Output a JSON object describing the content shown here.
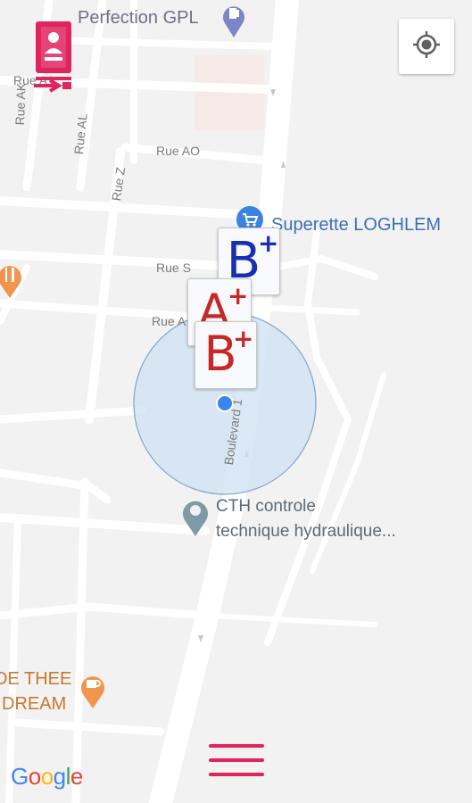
{
  "colors": {
    "map_bg": "#f2f2f2",
    "road": "#ffffff",
    "accuracy_fill": "#cfe0f3",
    "accuracy_stroke": "#7fa6cf",
    "location_dot": "#3a86ee",
    "accent": "#e0245e",
    "blood_b": "#1a2fb0",
    "blood_a": "#c62828"
  },
  "pois": {
    "perfection": "Perfection GPL",
    "superette": "Superette LOGHLEM",
    "cth_line1": "CTH controle",
    "cth_line2": "technique hydraulique...",
    "cafe_line1": "DE THEE",
    "cafe_line2": "DREAM"
  },
  "streets": {
    "rue_a1": "Rue A1",
    "rue_ak": "Rue AK",
    "rue_al": "Rue AL",
    "rue_ao": "Rue AO",
    "rue_z": "Rue Z",
    "rue_s": "Rue S",
    "rue_a": "Rue A",
    "boulevard": "Boulevard 1"
  },
  "markers": [
    {
      "group": "B",
      "sign": "+"
    },
    {
      "group": "A",
      "sign": "+"
    },
    {
      "group": "B",
      "sign": "+"
    }
  ],
  "icons": {
    "profile": "profile-card-icon",
    "locate": "my-location-icon",
    "menu": "hamburger-menu-icon",
    "gas": "gas-station-icon",
    "cart": "shopping-cart-icon",
    "pin": "location-pin-icon",
    "restaurant": "restaurant-icon",
    "cafe": "cafe-icon"
  },
  "attribution": "Google"
}
